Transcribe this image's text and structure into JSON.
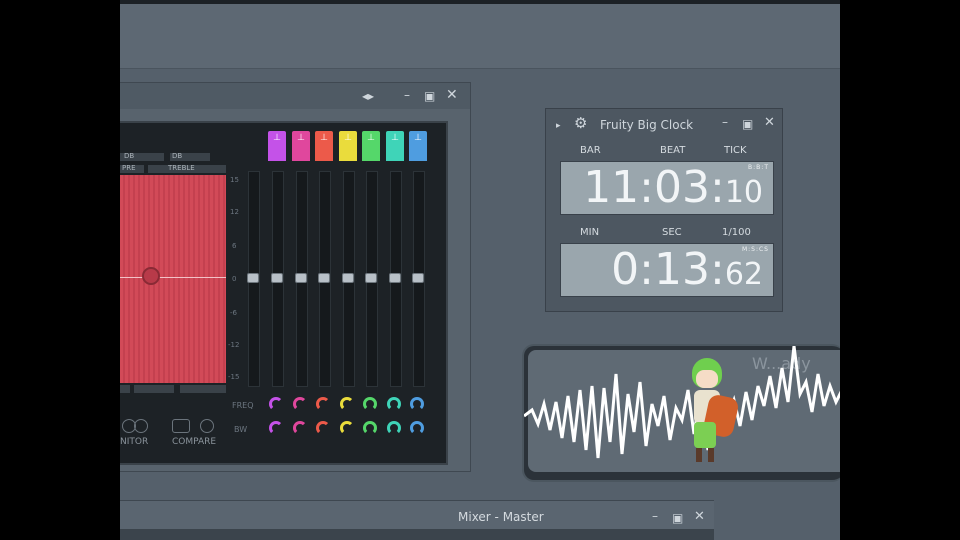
{
  "plugin": {
    "scale": [
      "15",
      "12",
      "6",
      "0",
      "-6",
      "-12",
      "-15"
    ],
    "mini_labels": [
      "DB",
      "DB",
      "PRE",
      "TREBLE"
    ],
    "pad_labels": [
      "",
      "",
      ""
    ],
    "band_colors": [
      "#c452e8",
      "#e0479d",
      "#ec5a4a",
      "#eadc3c",
      "#55d76a",
      "#3fd4b8",
      "#4f9de0"
    ],
    "band_glyphs": [
      "⊥",
      "⊥",
      "⊥",
      "⊥",
      "⊥",
      "⊥",
      "⊥"
    ],
    "row_labels": [
      "FREQ",
      "BW"
    ],
    "buttons": {
      "monitor": "NITOR",
      "compare": "COMPARE"
    }
  },
  "clock": {
    "title": "Fruity Big Clock",
    "row1_labels": [
      "BAR",
      "BEAT",
      "TICK"
    ],
    "row1_digits": {
      "main": "11:03:",
      "small": "10"
    },
    "row1_unit": "B:B:T",
    "row2_labels": [
      "MIN",
      "SEC",
      "1/100"
    ],
    "row2_digits": {
      "main": "0:13:",
      "small": "62"
    },
    "row2_unit": "M:S:CS"
  },
  "visualizer": {
    "text": "W...ady"
  },
  "mixer": {
    "title": "Mixer - Master"
  },
  "icons": {
    "gear": "gear-icon",
    "minimize": "minimize-icon",
    "maximize": "maximize-icon",
    "close": "close-icon"
  }
}
